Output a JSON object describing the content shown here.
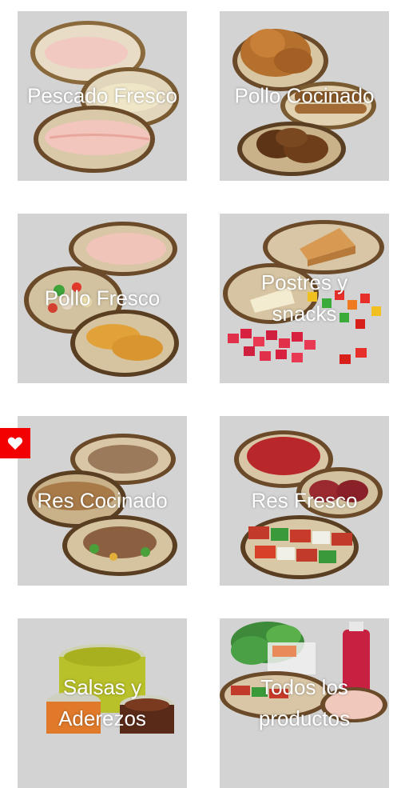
{
  "categories": [
    {
      "label": "Pescado Fresco",
      "image": "fish-fillets-plates"
    },
    {
      "label": "Pollo Cocinado",
      "image": "cooked-chicken-plates"
    },
    {
      "label": "Pollo Fresco",
      "image": "raw-chicken-plates"
    },
    {
      "label": "Postres y snacks",
      "image": "desserts-and-candy"
    },
    {
      "label": "Res Cocinado",
      "image": "cooked-beef-plates"
    },
    {
      "label": "Res Fresco",
      "image": "raw-beef-plates"
    },
    {
      "label": "Salsas y Aderezos",
      "image": "sauces-containers"
    },
    {
      "label": "Todos los productos",
      "image": "all-products-assortment"
    }
  ],
  "favorites": {
    "icon": "heart-icon",
    "color": "#f20000"
  },
  "colors": {
    "tile_bg": "#d3d3d3",
    "label": "#ffffff"
  }
}
